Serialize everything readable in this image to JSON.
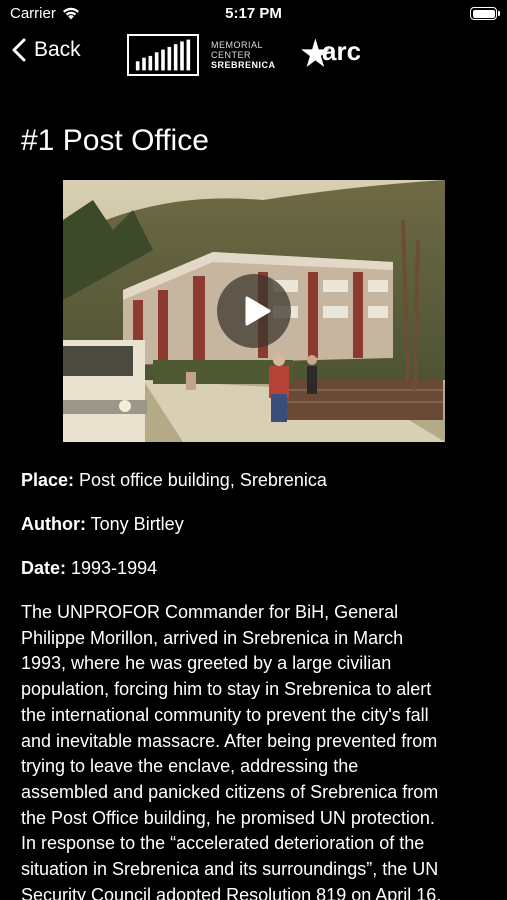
{
  "status_bar": {
    "carrier": "Carrier",
    "time": "5:17 PM"
  },
  "nav": {
    "back_label": "Back",
    "memorial_logo": {
      "line1": "MEMORIAL",
      "line2": "CENTER",
      "line3": "SREBRENICA"
    },
    "arci_logo": "arci"
  },
  "page": {
    "title": "#1 Post Office",
    "video": {
      "play_icon": "play-icon"
    },
    "place_label": "Place:",
    "place_value": " Post office building, Srebrenica",
    "author_label": "Author:",
    "author_value": " Tony Birtley",
    "date_label": "Date:",
    "date_value": " 1993-1994",
    "description_lines": [
      "The UNPROFOR Commander for BiH, General",
      "Philippe Morillon, arrived in Srebrenica in March",
      "1993, where he was greeted by a large civilian",
      "population, forcing him to stay in Srebrenica to alert",
      "the international community to prevent the city's fall",
      "and inevitable massacre. After being prevented from",
      "trying to leave the enclave, addressing the",
      "assembled and panicked citizens of Srebrenica from",
      "the Post Office building, he promised UN protection.",
      "In response to the “accelerated deterioration of the",
      "situation in Srebrenica and its surroundings”, the UN",
      "Security Council adopted Resolution 819 on April 16,"
    ]
  },
  "colors": {
    "background": "#000000",
    "text": "#ffffff"
  }
}
